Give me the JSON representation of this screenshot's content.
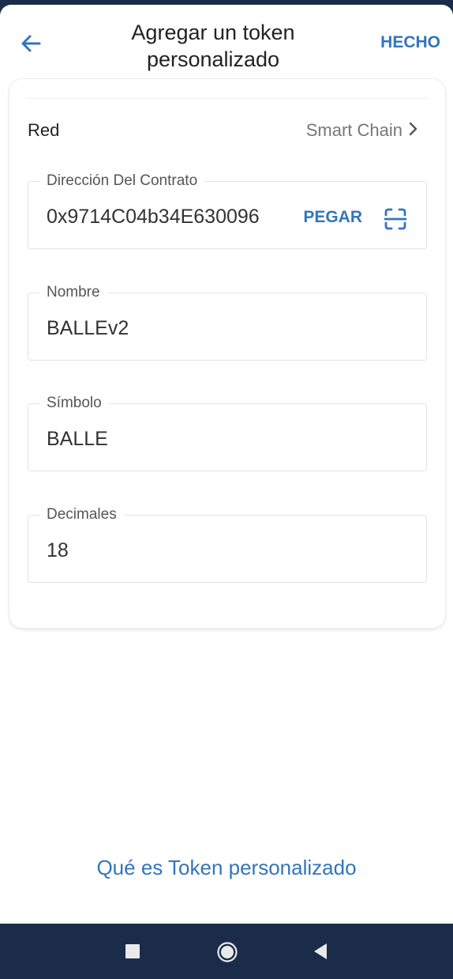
{
  "header": {
    "title": "Agregar un token personalizado",
    "back_icon": "arrow-left-icon",
    "done_label": "HECHO"
  },
  "form": {
    "network": {
      "label": "Red",
      "value": "Smart Chain",
      "icon": "chevron-right-icon"
    },
    "contract_address": {
      "label": "Dirección Del Contrato",
      "value": "0x9714C04b34E630096",
      "paste_label": "PEGAR",
      "scan_icon": "qr-scan-icon"
    },
    "name": {
      "label": "Nombre",
      "value": "BALLEv2"
    },
    "symbol": {
      "label": "Símbolo",
      "value": "BALLE"
    },
    "decimals": {
      "label": "Decimales",
      "value": "18"
    }
  },
  "help_link": "Qué es Token personalizado",
  "system_nav": {
    "buttons": [
      "recents-square-icon",
      "home-circle-icon",
      "back-triangle-icon"
    ]
  },
  "colors": {
    "accent": "#3375bb",
    "system_bar": "#1a2c4a",
    "text_primary": "#222222",
    "text_secondary": "#777777"
  }
}
